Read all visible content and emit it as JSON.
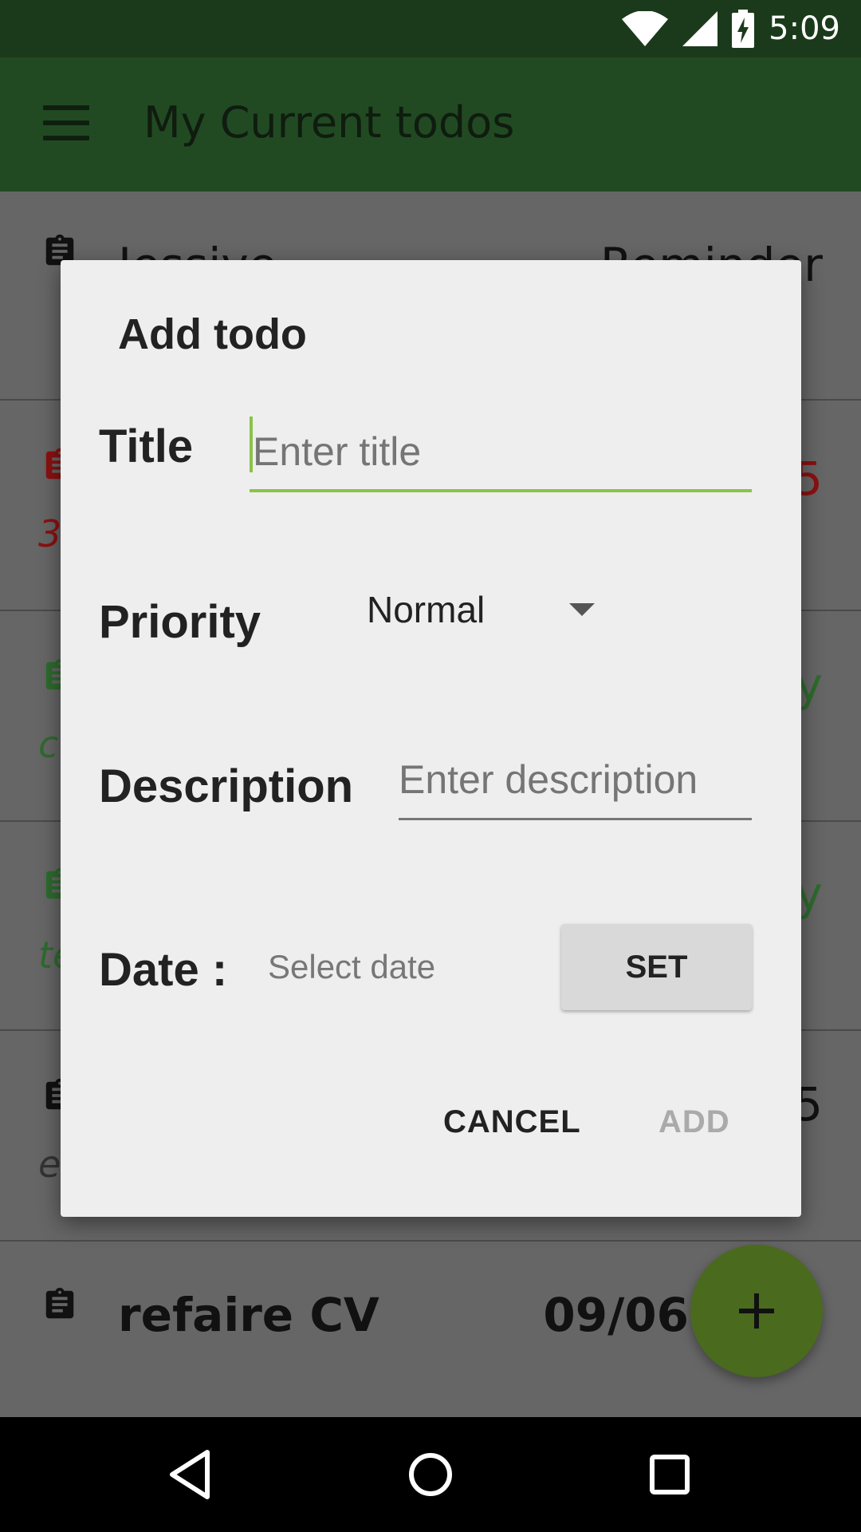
{
  "status_bar": {
    "time": "5:09",
    "icons": [
      "wifi-icon",
      "signal-icon",
      "battery-charging-icon"
    ]
  },
  "app_bar": {
    "title": "My Current todos",
    "menu_icon": "hamburger-menu-icon"
  },
  "background_list": {
    "rows": [
      {
        "name": "Jessive",
        "right": "Reminder",
        "sub": "",
        "color": "#111111"
      },
      {
        "name": "",
        "right": "5",
        "sub": "3",
        "color": "#8b1111"
      },
      {
        "name": "",
        "right": "y",
        "sub": "c",
        "color": "#2e6b2e"
      },
      {
        "name": "",
        "right": "y",
        "sub": "te",
        "color": "#2e6b2e"
      },
      {
        "name": "",
        "right": "5",
        "sub": "e",
        "color": "#111111"
      },
      {
        "name": "refaire CV",
        "right": "09/06",
        "sub": "",
        "color": "#111111"
      }
    ]
  },
  "dialog": {
    "title": "Add todo",
    "title_label": "Title",
    "title_placeholder": "Enter title",
    "priority_label": "Priority",
    "priority_value": "Normal",
    "description_label": "Description",
    "description_placeholder": "Enter description",
    "date_label": "Date :",
    "date_value": "Select date",
    "set_label": "SET",
    "cancel_label": "CANCEL",
    "add_label": "ADD"
  },
  "fab": {
    "icon": "plus-icon"
  },
  "nav_bar": {
    "icons": [
      "back-icon",
      "home-icon",
      "recents-icon"
    ]
  },
  "colors": {
    "status_bar": "#1b3a1b",
    "app_bar": "#214a22",
    "accent": "#8bc34a",
    "fab": "#4a6a1e",
    "dialog_bg": "#eeeeee"
  }
}
